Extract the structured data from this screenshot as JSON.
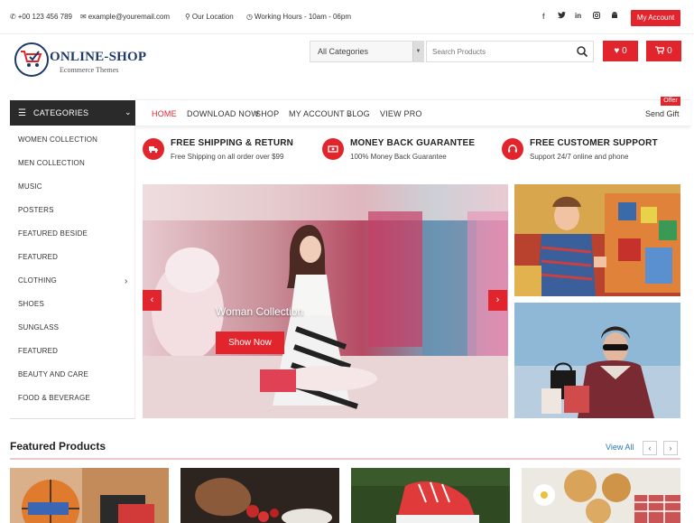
{
  "topbar": {
    "phone": "+00 123 456 789",
    "email": "example@youremail.com",
    "location": "Our Location",
    "hours": "Working Hours - 10am - 06pm",
    "my_account": "My Account"
  },
  "header": {
    "logo_title": "ONLINE-SHOP",
    "logo_subtitle": "Ecommerce Themes",
    "category_select": "All Categories",
    "search_placeholder": "Search Products",
    "wishlist_count": "0",
    "cart_count": "0"
  },
  "nav": {
    "items": [
      "HOME",
      "DOWNLOAD NOW",
      "SHOP",
      "MY ACCOUNT",
      "BLOG",
      "VIEW PRO"
    ],
    "offer_badge": "Offer",
    "send_gift": "Send Gift"
  },
  "categories": {
    "title": "CATEGORIES",
    "items": [
      "WOMEN COLLECTION",
      "MEN COLLECTION",
      "MUSIC",
      "POSTERS",
      "FEATURED BESIDE",
      "FEATURED",
      "CLOTHING",
      "SHOES",
      "SUNGLASS",
      "FEATURED",
      "BEAUTY AND CARE",
      "FOOD & BEVERAGE"
    ]
  },
  "features": [
    {
      "title": "FREE SHIPPING & RETURN",
      "subtitle": "Free Shipping on all order over $99",
      "icon": "truck-icon"
    },
    {
      "title": "MONEY BACK GUARANTEE",
      "subtitle": "100% Money Back Guarantee",
      "icon": "money-icon"
    },
    {
      "title": "FREE CUSTOMER SUPPORT",
      "subtitle": "Support 24/7 online and phone",
      "icon": "headset-icon"
    }
  ],
  "slider": {
    "caption": "Woman Collection",
    "button": "Show Now"
  },
  "featured_products": {
    "title": "Featured Products",
    "view_all": "View All"
  },
  "colors": {
    "accent": "#e2242c",
    "dark": "#2a2a2a",
    "brand": "#1f3a68",
    "link": "#2a7ab0"
  }
}
